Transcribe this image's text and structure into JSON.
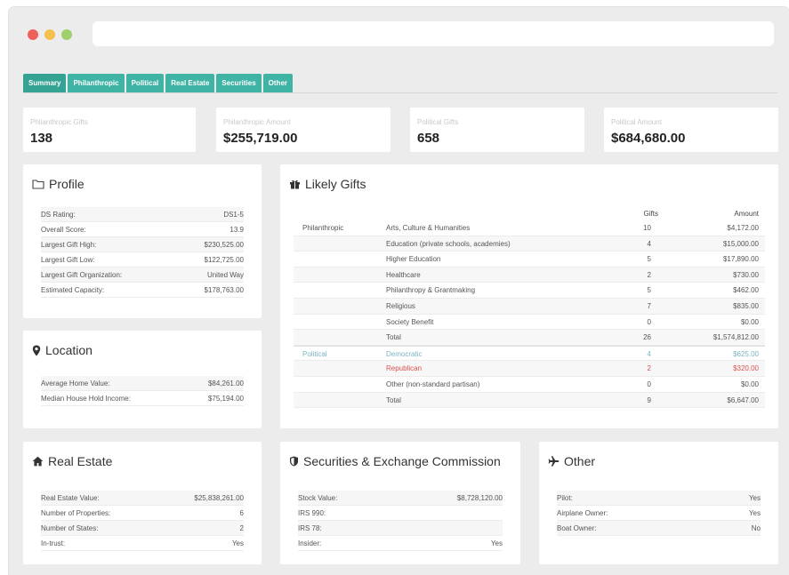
{
  "tabs": [
    "Summary",
    "Philanthropic",
    "Political",
    "Real Estate",
    "Securities",
    "Other"
  ],
  "stats": [
    {
      "label": "Philanthropic Gifts",
      "value": "138"
    },
    {
      "label": "Philanthropic Amount",
      "value": "$255,719.00"
    },
    {
      "label": "Political Gifts",
      "value": "658"
    },
    {
      "label": "Political Amount",
      "value": "$684,680.00"
    }
  ],
  "profile": {
    "title": "Profile",
    "rows": [
      {
        "label": "DS Rating:",
        "value": "DS1-5"
      },
      {
        "label": "Overall Score:",
        "value": "13.9"
      },
      {
        "label": "Largest Gift High:",
        "value": "$230,525.00"
      },
      {
        "label": "Largest Gift Low:",
        "value": "$122,725.00"
      },
      {
        "label": "Largest Gift Organization:",
        "value": "United Way"
      },
      {
        "label": "Estimated Capacity:",
        "value": "$178,763.00"
      }
    ]
  },
  "location": {
    "title": "Location",
    "rows": [
      {
        "label": "Average Home Value:",
        "value": "$84,261.00"
      },
      {
        "label": "Median House Hold Income:",
        "value": "$75,194.00"
      }
    ]
  },
  "likely_gifts": {
    "title": "Likely Gifts",
    "col_gifts": "Gifts",
    "col_amount": "Amount",
    "rows": [
      {
        "type": "Philanthropic",
        "category": "Arts, Culture & Humanities",
        "gifts": "10",
        "amount": "$4,172.00",
        "style": ""
      },
      {
        "type": "",
        "category": "Education (private schools, academies)",
        "gifts": "4",
        "amount": "$15,000.00",
        "style": ""
      },
      {
        "type": "",
        "category": "Higher Education",
        "gifts": "5",
        "amount": "$17,890.00",
        "style": ""
      },
      {
        "type": "",
        "category": "Healthcare",
        "gifts": "2",
        "amount": "$730.00",
        "style": ""
      },
      {
        "type": "",
        "category": "Philanthropy & Grantmaking",
        "gifts": "5",
        "amount": "$462.00",
        "style": ""
      },
      {
        "type": "",
        "category": "Religious",
        "gifts": "7",
        "amount": "$835.00",
        "style": ""
      },
      {
        "type": "",
        "category": "Society Benefit",
        "gifts": "0",
        "amount": "$0.00",
        "style": ""
      },
      {
        "type": "",
        "category": "Total",
        "gifts": "26",
        "amount": "$1,574,812.00",
        "style": ""
      },
      {
        "type": "Political",
        "category": "Democratic",
        "gifts": "4",
        "amount": "$625.00",
        "style": "dem sep"
      },
      {
        "type": "",
        "category": "Republican",
        "gifts": "2",
        "amount": "$320.00",
        "style": "rep"
      },
      {
        "type": "",
        "category": "Other (non-standard partisan)",
        "gifts": "0",
        "amount": "$0.00",
        "style": ""
      },
      {
        "type": "",
        "category": "Total",
        "gifts": "9",
        "amount": "$6,647.00",
        "style": ""
      }
    ]
  },
  "real_estate": {
    "title": "Real Estate",
    "rows": [
      {
        "label": "Real Estate Value:",
        "value": "$25,838,261.00"
      },
      {
        "label": "Number of Properties:",
        "value": "6"
      },
      {
        "label": "Number of States:",
        "value": "2"
      },
      {
        "label": "In-trust:",
        "value": "Yes"
      }
    ]
  },
  "securities": {
    "title": "Securities & Exchange Commission",
    "rows": [
      {
        "label": "Stock Value:",
        "value": "$8,728,120.00"
      },
      {
        "label": "IRS 990:",
        "value": ""
      },
      {
        "label": "IRS 78:",
        "value": ""
      },
      {
        "label": "Insider:",
        "value": "Yes"
      }
    ]
  },
  "other": {
    "title": "Other",
    "rows": [
      {
        "label": "Pilot:",
        "value": "Yes"
      },
      {
        "label": "Airplane Owner:",
        "value": "Yes"
      },
      {
        "label": "Boat Owner:",
        "value": "No"
      }
    ]
  }
}
